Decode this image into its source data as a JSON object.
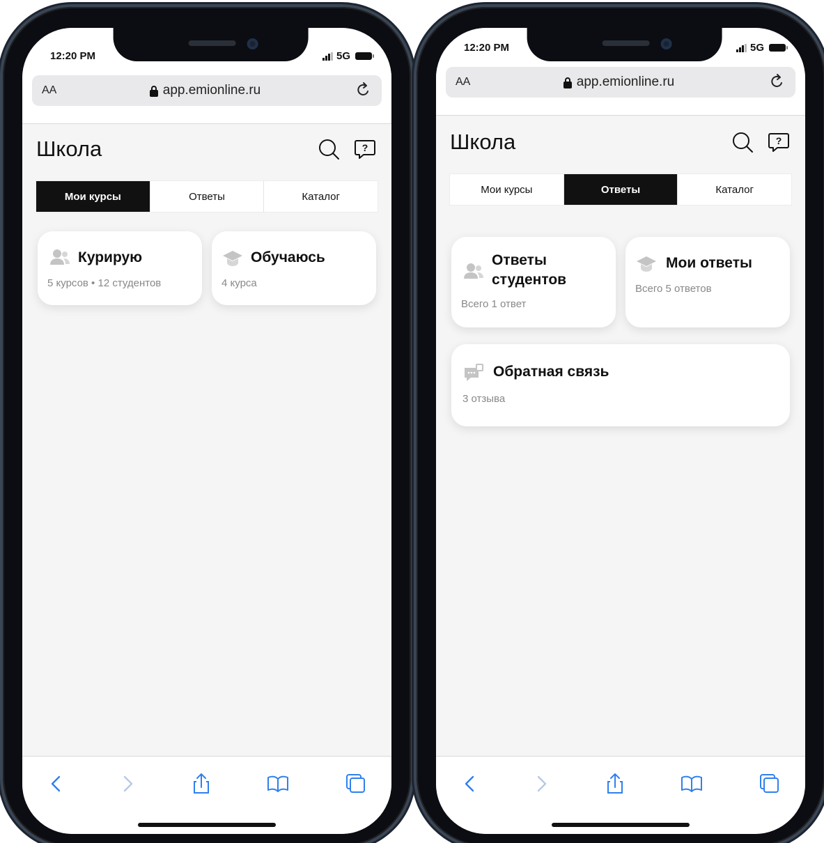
{
  "left": {
    "status": {
      "time": "12:20 PM",
      "network": "5G"
    },
    "browser": {
      "aa_label": "AA",
      "url": "app.emionline.ru"
    },
    "page": {
      "title": "Школа"
    },
    "tabs": [
      {
        "label": "Мои курсы",
        "active": true
      },
      {
        "label": "Ответы",
        "active": false
      },
      {
        "label": "Каталог",
        "active": false
      }
    ],
    "cards": [
      {
        "title": "Курирую",
        "subtitle": "5 курсов • 12 студентов",
        "icon": "users-icon"
      },
      {
        "title": "Обучаюсь",
        "subtitle": "4 курса",
        "icon": "graduation-cap-icon"
      }
    ]
  },
  "right": {
    "status": {
      "time": "12:20 PM",
      "network": "5G"
    },
    "browser": {
      "aa_label": "AA",
      "url": "app.emionline.ru"
    },
    "page": {
      "title": "Школа"
    },
    "tabs": [
      {
        "label": "Мои курсы",
        "active": false
      },
      {
        "label": "Ответы",
        "active": true
      },
      {
        "label": "Каталог",
        "active": false
      }
    ],
    "cards": [
      {
        "title_line1": "Ответы",
        "title_line2": "студентов",
        "subtitle": "Всего 1 ответ",
        "icon": "users-icon"
      },
      {
        "title": "Мои ответы",
        "subtitle": "Всего 5 ответов",
        "icon": "graduation-cap-icon"
      },
      {
        "title": "Обратная связь",
        "subtitle": "3 отзыва",
        "icon": "feedback-chat-icon"
      }
    ]
  },
  "colors": {
    "accent": "#111111",
    "background": "#f5f5f5",
    "ios_blue": "#2f80ed",
    "muted_icon": "#c4c4c4"
  }
}
